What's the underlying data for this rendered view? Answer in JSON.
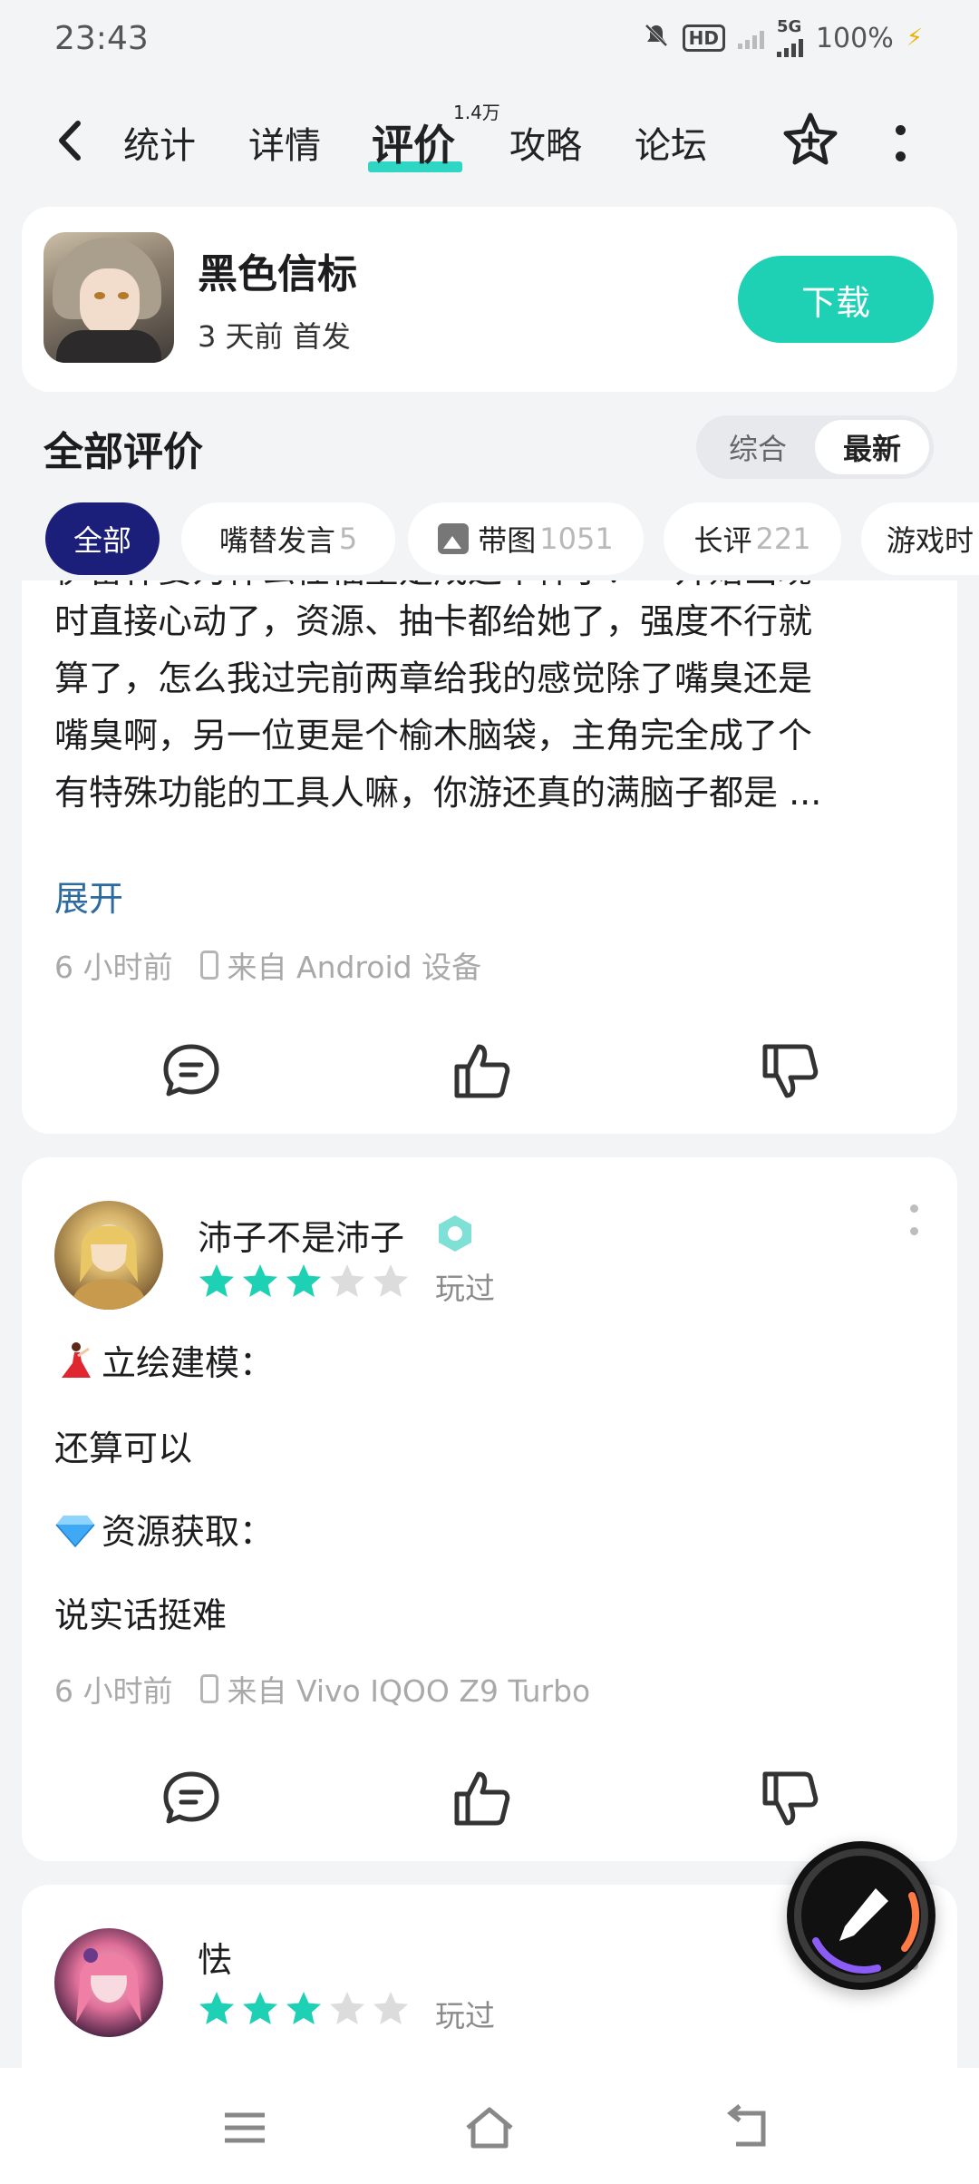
{
  "status_bar": {
    "time": "23:43",
    "network": "5G",
    "battery": "100%",
    "icons": [
      "mute-icon",
      "hd-icon",
      "signal-icon",
      "battery-charging-icon"
    ]
  },
  "nav": {
    "tabs": [
      {
        "label": "统计"
      },
      {
        "label": "详情"
      },
      {
        "label": "评价"
      },
      {
        "label": "攻略"
      },
      {
        "label": "论坛"
      }
    ],
    "active_tab": "评价",
    "review_count_badge": "1.4万",
    "accent_color": "#2fd6c3"
  },
  "game": {
    "title": "黑色信标",
    "subtitle": "3 天前 首发",
    "download_label": "下载",
    "download_color": "#1ed1b4"
  },
  "reviews_section": {
    "title": "全部评价",
    "sort_options": [
      "综合",
      "最新"
    ],
    "sort_selected": "最新"
  },
  "filters": {
    "chips": [
      {
        "label": "全部",
        "count": ""
      },
      {
        "label": "嘴替发言",
        "count": "5"
      },
      {
        "label": "带图",
        "count": "1051"
      },
      {
        "label": "长评",
        "count": "221"
      },
      {
        "label": "游戏时",
        "count": ""
      }
    ],
    "active_color": "#1b1f7a"
  },
  "reviews": [
    {
      "partial_top_line": "伊雷什要为什么任福星是成这个样子？一开始出现",
      "body_lines": [
        "时直接心动了，资源、抽卡都给她了，强度不行就",
        "算了，怎么我过完前两章给我的感觉除了嘴臭还是",
        "嘴臭啊，另一位更是个榆木脑袋，主角完全成了个",
        "有特殊功能的工具人嘛，你游还真的满脑子都是 ..."
      ],
      "expand_label": "展开",
      "time": "6 小时前",
      "device": "来自 Android 设备"
    },
    {
      "username": "沛子不是沛子",
      "rating": 3,
      "max_rating": 5,
      "played_label": "玩过",
      "lines": [
        {
          "emoji": "dancer-emoji",
          "text": "立绘建模："
        },
        {
          "emoji": "",
          "text": "还算可以"
        },
        {
          "emoji": "gem-emoji",
          "text": "资源获取："
        },
        {
          "emoji": "",
          "text": "说实话挺难"
        }
      ],
      "time": "6 小时前",
      "device": "来自 Vivo IQOO Z9 Turbo"
    },
    {
      "username": "怯",
      "rating": 3,
      "max_rating": 5,
      "played_label": "玩过"
    }
  ],
  "star_color": "#1ed1b4",
  "star_empty_color": "#dcdcdc"
}
